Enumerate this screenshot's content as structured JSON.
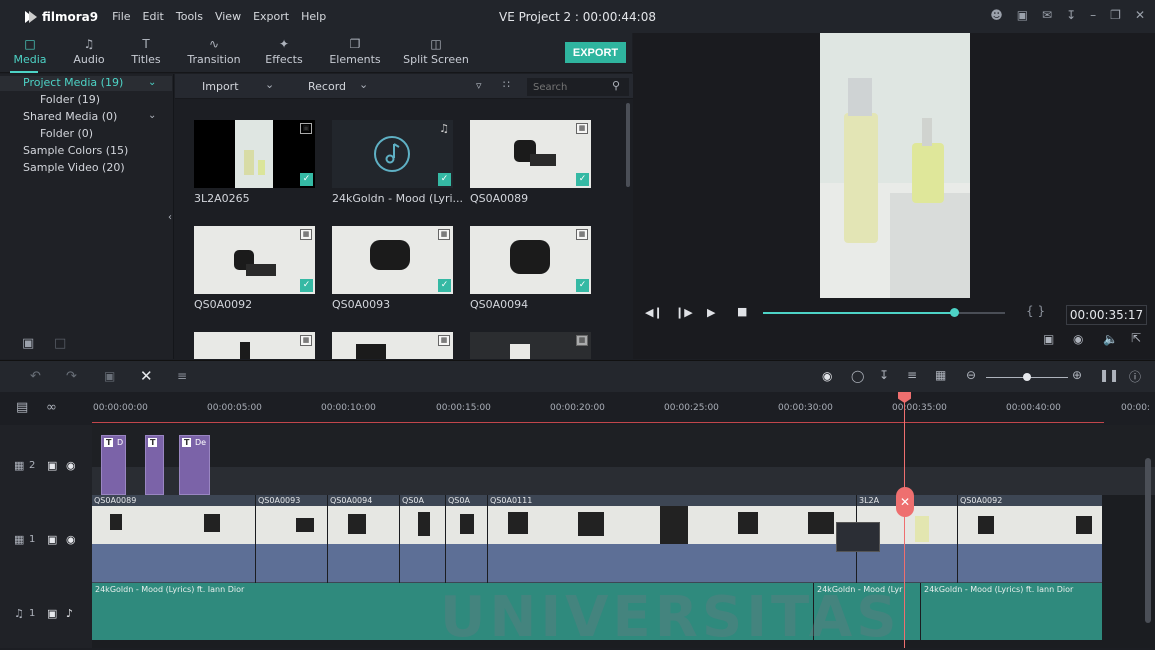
{
  "app": {
    "logo_text": "filmora9",
    "project_title": "VE Project 2 : 00:00:44:08",
    "menu": [
      "File",
      "Edit",
      "Tools",
      "View",
      "Export",
      "Help"
    ]
  },
  "toolbar": {
    "tabs": [
      {
        "label": "Media",
        "icon": "folder-icon"
      },
      {
        "label": "Audio",
        "icon": "music-note-icon"
      },
      {
        "label": "Titles",
        "icon": "text-icon"
      },
      {
        "label": "Transition",
        "icon": "transition-icon"
      },
      {
        "label": "Effects",
        "icon": "effects-icon"
      },
      {
        "label": "Elements",
        "icon": "elements-icon"
      },
      {
        "label": "Split Screen",
        "icon": "split-screen-icon"
      }
    ],
    "export_label": "EXPORT"
  },
  "library": {
    "items": [
      {
        "label": "Project Media (19)",
        "active": true
      },
      {
        "label": "Folder (19)",
        "active": false
      },
      {
        "label": "Shared Media (0)",
        "active": false
      },
      {
        "label": "Folder (0)",
        "active": false
      },
      {
        "label": "Sample Colors (15)",
        "active": false
      },
      {
        "label": "Sample Video (20)",
        "active": false
      }
    ]
  },
  "mediabar": {
    "import_label": "Import",
    "record_label": "Record",
    "search_placeholder": "Search"
  },
  "media": {
    "items": [
      {
        "label": "3L2A0265",
        "type": "image"
      },
      {
        "label": "24kGoldn - Mood (Lyri...",
        "type": "audio"
      },
      {
        "label": "QS0A0089",
        "type": "video"
      },
      {
        "label": "QS0A0092",
        "type": "video"
      },
      {
        "label": "QS0A0093",
        "type": "video"
      },
      {
        "label": "QS0A0094",
        "type": "video"
      }
    ]
  },
  "preview": {
    "timecode": "00:00:35:17",
    "progress": 0.79
  },
  "ruler": {
    "ticks": [
      "00:00:00:00",
      "00:00:05:00",
      "00:00:10:00",
      "00:00:15:00",
      "00:00:20:00",
      "00:00:25:00",
      "00:00:30:00",
      "00:00:35:00",
      "00:00:40:00",
      "00:00:"
    ]
  },
  "timeline": {
    "track_video2": "2",
    "track_video1": "1",
    "track_audio1": "1",
    "title_clips": [
      "D",
      "",
      "De"
    ],
    "video_clips": [
      "QS0A0089",
      "QS0A0093",
      "QS0A0094",
      "QS0A",
      "QS0A",
      "QS0A0111",
      "3L2A",
      "QS0A0092"
    ],
    "audio_clips": [
      "24kGoldn - Mood (Lyrics) ft. Iann Dior",
      "24kGoldn - Mood (Lyr",
      "24kGoldn - Mood (Lyrics) ft. Iann Dior"
    ],
    "zoom_level": 0.5
  },
  "watermark": "UNIVERSITAS",
  "colors": {
    "accent": "#4dd3c6",
    "export": "#2fb59f",
    "title_clip": "#7b63a8",
    "audio_clip": "#2f8a7d",
    "playhead": "#ee6f6f"
  }
}
